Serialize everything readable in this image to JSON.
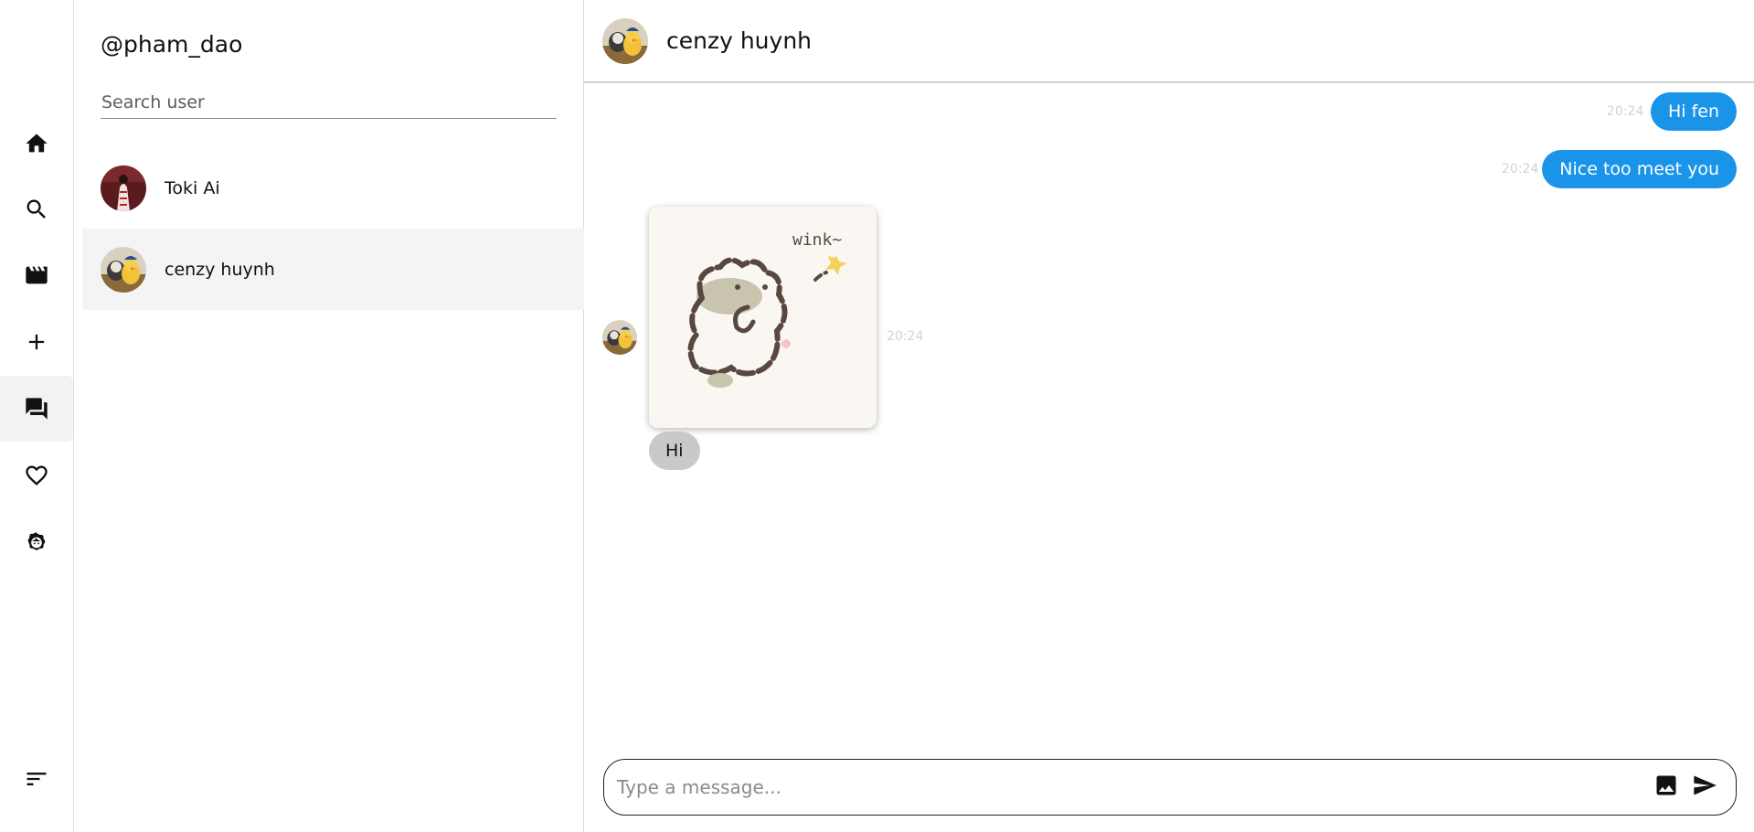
{
  "nav": {
    "items": [
      {
        "icon": "home-icon"
      },
      {
        "icon": "search-icon"
      },
      {
        "icon": "reels-icon"
      },
      {
        "icon": "create-icon"
      },
      {
        "icon": "messages-icon",
        "active": true
      },
      {
        "icon": "heart-icon"
      },
      {
        "icon": "profile-icon"
      }
    ],
    "menu_icon": "menu-icon"
  },
  "sidebar": {
    "username": "@pham_dao",
    "search_placeholder": "Search user",
    "conversations": [
      {
        "name": "Toki Ai",
        "avatar": "avatar-toki-ai"
      },
      {
        "name": "cenzy huynh",
        "avatar": "avatar-cenzy-huynh",
        "selected": true
      }
    ]
  },
  "chat": {
    "header_name": "cenzy huynh",
    "messages": [
      {
        "direction": "out",
        "text": "Hi fen",
        "time": "20:24"
      },
      {
        "direction": "out",
        "text": "Nice too meet you",
        "time": "20:24"
      },
      {
        "direction": "in",
        "type": "sticker",
        "sticker_text": "wink~",
        "time": "20:24"
      },
      {
        "direction": "in",
        "text": "Hi"
      }
    ],
    "composer": {
      "placeholder": "Type a message...",
      "image_icon": "image-icon",
      "send_icon": "send-icon"
    }
  },
  "colors": {
    "outgoing_bubble": "#1a94e9",
    "incoming_bubble": "#c9c9c9",
    "selected_row": "#f4f4f4"
  }
}
